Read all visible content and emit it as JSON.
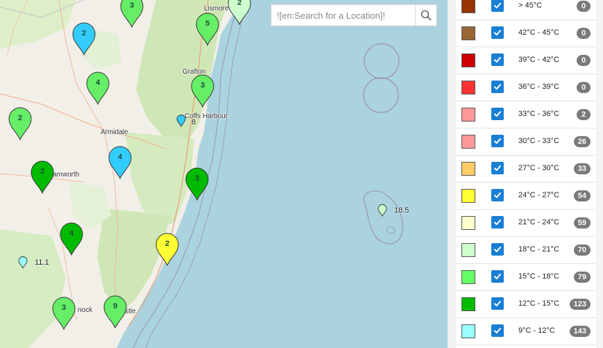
{
  "search": {
    "placeholder": "![en:Search for a Location]!"
  },
  "map": {
    "places": [
      {
        "id": "lismore",
        "name": "Lismore"
      },
      {
        "id": "grafton",
        "name": "Grafton"
      },
      {
        "id": "coffs",
        "name": "Coffs Harbour"
      },
      {
        "id": "armidale",
        "name": "Armidale"
      },
      {
        "id": "tamworth",
        "name": "amworth"
      },
      {
        "id": "cessnock",
        "name": "nock"
      },
      {
        "id": "newcastle",
        "name": "stle"
      }
    ],
    "clusters": [
      {
        "id": "c1",
        "count": "3",
        "color": "#66ee66"
      },
      {
        "id": "c2",
        "count": "2",
        "color": "#ccffcc"
      },
      {
        "id": "c3",
        "count": "2",
        "color": "#33ccff"
      },
      {
        "id": "c4",
        "count": "5",
        "color": "#66ee66"
      },
      {
        "id": "c5",
        "count": "4",
        "color": "#66ee66"
      },
      {
        "id": "c6",
        "count": "3",
        "color": "#66ee66"
      },
      {
        "id": "c7",
        "count": "2",
        "color": "#66ee66"
      },
      {
        "id": "c8",
        "count": "4",
        "color": "#33ccff"
      },
      {
        "id": "c9",
        "count": "2",
        "color": "#00bb00"
      },
      {
        "id": "c10",
        "count": "3",
        "color": "#00bb00"
      },
      {
        "id": "c11",
        "count": "4",
        "color": "#00bb00"
      },
      {
        "id": "c12",
        "count": "2",
        "color": "#ffff33"
      },
      {
        "id": "c13",
        "count": "3",
        "color": "#66ee66"
      },
      {
        "id": "c14",
        "count": "9",
        "color": "#66ee66"
      }
    ],
    "stations": [
      {
        "id": "s1",
        "value": "8",
        "color": "#33ccff"
      },
      {
        "id": "s2",
        "value": "18.5",
        "color": "#ccffcc"
      },
      {
        "id": "s3",
        "value": "11.1",
        "color": "#99ffff"
      }
    ]
  },
  "legend": {
    "rows": [
      {
        "label": "> 45°C",
        "count": "0",
        "color": "#993300"
      },
      {
        "label": "42°C - 45°C",
        "count": "0",
        "color": "#996633"
      },
      {
        "label": "39°C - 42°C",
        "count": "0",
        "color": "#cc0000"
      },
      {
        "label": "36°C - 39°C",
        "count": "0",
        "color": "#ff3333"
      },
      {
        "label": "33°C - 36°C",
        "count": "2",
        "color": "#ff9999"
      },
      {
        "label": "30°C - 33°C",
        "count": "26",
        "color": "#ff9999"
      },
      {
        "label": "27°C - 30°C",
        "count": "33",
        "color": "#ffcc66"
      },
      {
        "label": "24°C - 27°C",
        "count": "54",
        "color": "#ffff33"
      },
      {
        "label": "21°C - 24°C",
        "count": "59",
        "color": "#ffffcc"
      },
      {
        "label": "18°C - 21°C",
        "count": "70",
        "color": "#ccffcc"
      },
      {
        "label": "15°C - 18°C",
        "count": "79",
        "color": "#66ff66"
      },
      {
        "label": "12°C - 15°C",
        "count": "123",
        "color": "#00bb00"
      },
      {
        "label": "9°C - 12°C",
        "count": "143",
        "color": "#99ffff"
      }
    ]
  }
}
